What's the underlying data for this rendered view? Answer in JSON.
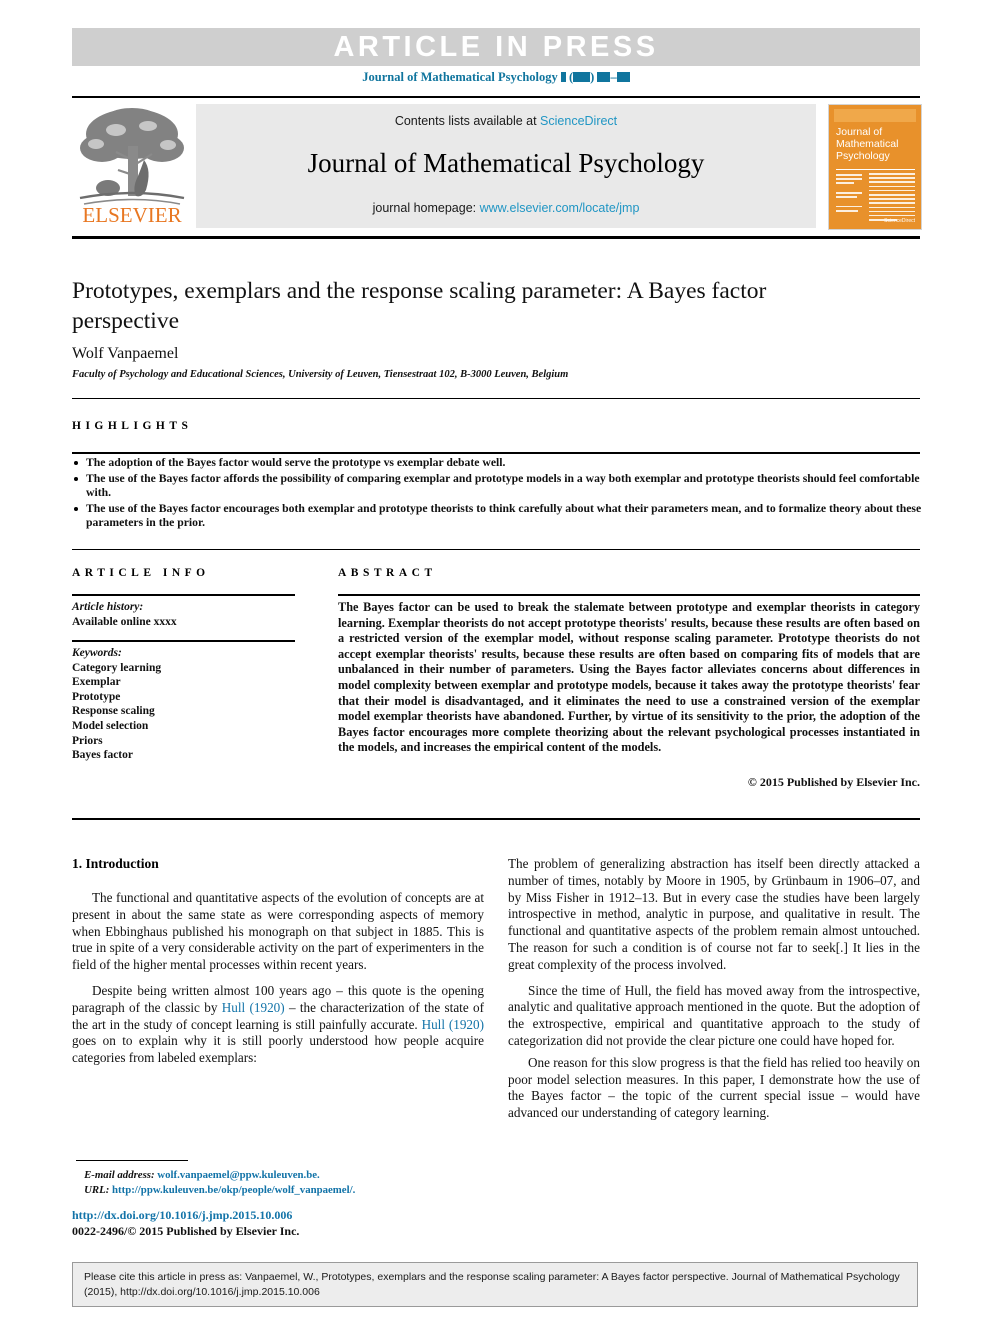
{
  "banner": {
    "article_in_press": "ARTICLE IN PRESS",
    "journal_ref_prefix": "Journal of Mathematical Psychology"
  },
  "masthead": {
    "contents_prefix": "Contents lists available at ",
    "contents_link": "ScienceDirect",
    "journal_title": "Journal of Mathematical Psychology",
    "homepage_prefix": "journal homepage: ",
    "homepage_link": "www.elsevier.com/locate/jmp",
    "publisher": "ELSEVIER",
    "cover_title": "Journal of\nMathematical\nPsychology",
    "cover_footer": "ScienceDirect",
    "accent_orange": "#e87722",
    "accent_blue": "#2196c4"
  },
  "article": {
    "title": "Prototypes, exemplars and the response scaling parameter: A Bayes factor perspective",
    "author": "Wolf Vanpaemel",
    "affiliation": "Faculty of Psychology and Educational Sciences, University of Leuven, Tiensestraat 102, B-3000 Leuven, Belgium"
  },
  "highlights": {
    "heading": "HIGHLIGHTS",
    "items": [
      "The adoption of the Bayes factor would serve the prototype vs exemplar debate well.",
      "The use of the Bayes factor affords the possibility of comparing exemplar and prototype models in a way both exemplar and prototype theorists should feel comfortable with.",
      "The use of the Bayes factor encourages both exemplar and prototype theorists to think carefully about what their parameters mean, and to formalize theory about these parameters in the prior."
    ]
  },
  "article_info": {
    "heading": "ARTICLE INFO",
    "history_label": "Article history:",
    "history_value": "Available online xxxx",
    "keywords_label": "Keywords:",
    "keywords": [
      "Category learning",
      "Exemplar",
      "Prototype",
      "Response scaling",
      "Model selection",
      "Priors",
      "Bayes factor"
    ]
  },
  "abstract": {
    "heading": "ABSTRACT",
    "text": "The Bayes factor can be used to break the stalemate between prototype and exemplar theorists in category learning. Exemplar theorists do not accept prototype theorists' results, because these results are often based on a restricted version of the exemplar model, without response scaling parameter. Prototype theorists do not accept exemplar theorists' results, because these results are often based on comparing fits of models that are unbalanced in their number of parameters. Using the Bayes factor alleviates concerns about differences in model complexity between exemplar and prototype models, because it takes away the prototype theorists' fear that their model is disadvantaged, and it eliminates the need to use a constrained version of the exemplar model exemplar theorists have abandoned. Further, by virtue of its sensitivity to the prior, the adoption of the Bayes factor encourages more complete theorizing about the relevant psychological processes instantiated in the models, and increases the empirical content of the models.",
    "copyright": "© 2015 Published by Elsevier Inc."
  },
  "body": {
    "section_heading": "1. Introduction",
    "left_paragraphs": [
      "The functional and quantitative aspects of the evolution of concepts are at present in about the same state as were corresponding aspects of memory when Ebbinghaus published his monograph on that subject in 1885. This is true in spite of a very considerable activity on the part of experimenters in the field of the higher mental processes within recent years."
    ],
    "left_para2_part1": "Despite being written almost 100 years ago – this quote is the opening paragraph of the classic by ",
    "left_para2_ref1": "Hull (1920)",
    "left_para2_part2": " – the characterization of the state of the art in the study of concept learning is still painfully accurate. ",
    "left_para2_ref2": "Hull (1920)",
    "left_para2_part3": " goes on to explain why it is still poorly understood how people acquire categories from labeled exemplars:",
    "right_paragraphs": [
      "The problem of generalizing abstraction has itself been directly attacked a number of times, notably by Moore in 1905, by Grünbaum in 1906–07, and by Miss Fisher in 1912–13. But in every case the studies have been largely introspective in method, analytic in purpose, and qualitative in result. The functional and quantitative aspects of the problem remain almost untouched. The reason for such a condition is of course not far to seek[.] It lies in the great complexity of the process involved.",
      "Since the time of Hull, the field has moved away from the introspective, analytic and qualitative approach mentioned in the quote. But the adoption of the extrospective, empirical and quantitative approach to the study of categorization did not provide the clear picture one could have hoped for.",
      "One reason for this slow progress is that the field has relied too heavily on poor model selection measures. In this paper, I demonstrate how the use of the Bayes factor – the topic of the current special issue – would have advanced our understanding of category learning."
    ]
  },
  "footnote": {
    "email_label": "E-mail address:",
    "email_value": "wolf.vanpaemel@ppw.kuleuven.be.",
    "url_label": "URL:",
    "url_value": "http://ppw.kuleuven.be/okp/people/wolf_vanpaemel/.",
    "doi": "http://dx.doi.org/10.1016/j.jmp.2015.10.006",
    "issn_line": "0022-2496/© 2015 Published by Elsevier Inc."
  },
  "citation": {
    "text": "Please cite this article in press as: Vanpaemel, W., Prototypes, exemplars and the response scaling parameter: A Bayes factor perspective. Journal of Mathematical Psychology (2015), http://dx.doi.org/10.1016/j.jmp.2015.10.006"
  }
}
